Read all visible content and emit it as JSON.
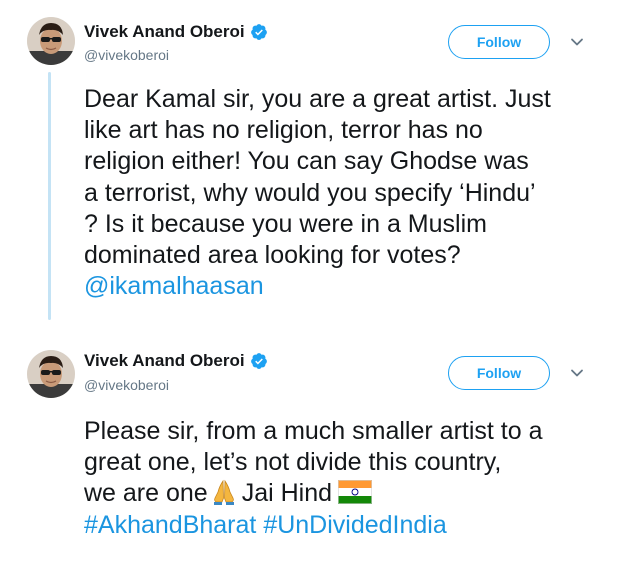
{
  "tweets": [
    {
      "author": {
        "name": "Vivek Anand Oberoi",
        "handle": "@vivekoberoi",
        "verified": true,
        "avatar_icon": "avatar-photo"
      },
      "follow_label": "Follow",
      "menu_icon": "chevron-down-icon",
      "text_lines": [
        "Dear Kamal sir, you are a great artist. Just",
        "like art has no religion, terror has no",
        "religion either! You can say Ghodse was",
        "a terrorist, why would you specify ‘Hindu’",
        "? Is it because you were in a Muslim",
        "dominated area looking for votes?"
      ],
      "mention": "@ikamalhaasan"
    },
    {
      "author": {
        "name": "Vivek Anand Oberoi",
        "handle": "@vivekoberoi",
        "verified": true,
        "avatar_icon": "avatar-photo"
      },
      "follow_label": "Follow",
      "menu_icon": "chevron-down-icon",
      "text_lines": [
        "Please sir, from a much smaller artist to a",
        "great one, let’s not divide this country,"
      ],
      "line3_start": "we are one",
      "line3_end": "Jai Hind",
      "emojis": [
        "folded-hands-icon",
        "india-flag-icon"
      ],
      "hashtags": [
        "#AkhandBharat",
        "#UnDividedIndia"
      ]
    }
  ],
  "colors": {
    "link": "#1b95e0",
    "follow": "#1da1f2",
    "handle": "#657786",
    "thread_line": "#c4e3f5",
    "verified": "#1da1f2"
  }
}
